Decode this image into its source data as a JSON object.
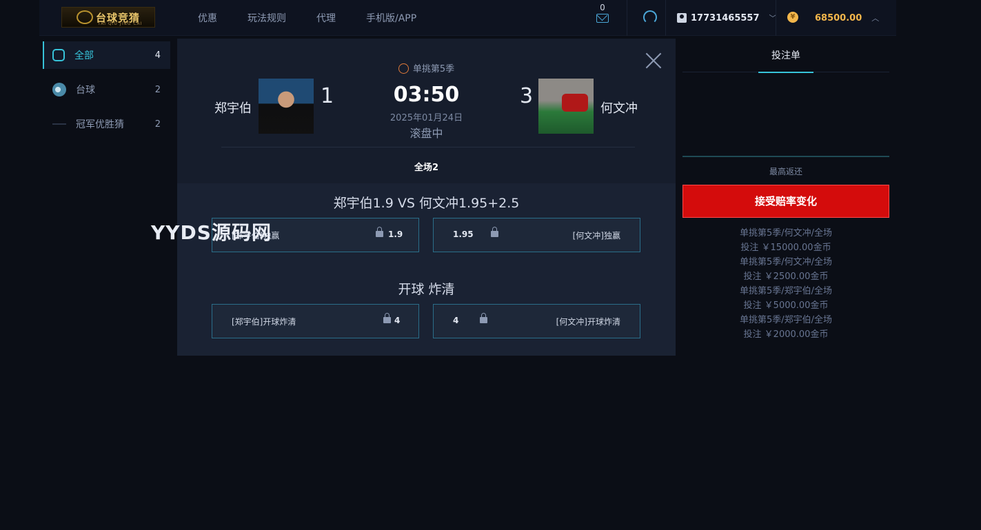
{
  "header": {
    "logo_text": "台球竞猜",
    "logo_sub": "TAI QIU JING CAI",
    "nav": [
      "优惠",
      "玩法规则",
      "代理",
      "手机版/APP"
    ],
    "mail_count": "0",
    "username": "17731465557",
    "balance": "68500.00",
    "coin_symbol": "¥"
  },
  "sidebar": {
    "items": [
      {
        "label": "全部",
        "count": "4"
      },
      {
        "label": "台球",
        "count": "2"
      },
      {
        "label": "冠军优胜猜",
        "count": "2"
      }
    ]
  },
  "match": {
    "league": "单挑第5季",
    "left_team": "郑宇伯",
    "left_score": "1",
    "clock": "03:50",
    "date": "2025年01月24日",
    "status": "滚盘中",
    "right_score": "3",
    "right_team": "何文冲",
    "period": "全场2"
  },
  "markets": [
    {
      "title": "郑宇伯1.9 VS 何文冲1.95+2.5",
      "left": {
        "label": "[郑宇伯]独赢",
        "odds": "1.9"
      },
      "right": {
        "label": "[何文冲]独赢",
        "odds": "1.95"
      }
    },
    {
      "title": "开球 炸清",
      "left": {
        "label": "[郑宇伯]开球炸清",
        "odds": "4"
      },
      "right": {
        "label": "[何文冲]开球炸清",
        "odds": "4"
      }
    }
  ],
  "watermark": "YYDS源码网",
  "betslip": {
    "tab": "投注单",
    "max_return_label": "最高返还",
    "accept_button": "接受赔率变化",
    "history": [
      "单挑第5季/何文冲/全场",
      "投注 ￥15000.00金币",
      "单挑第5季/何文冲/全场",
      "投注 ￥2500.00金币",
      "单挑第5季/郑宇伯/全场",
      "投注 ￥5000.00金币",
      "单挑第5季/郑宇伯/全场",
      "投注 ￥2000.00金币"
    ]
  },
  "colors": {
    "accent": "#37c3d9",
    "gold": "#f2b64b",
    "danger": "#d40c0c"
  }
}
